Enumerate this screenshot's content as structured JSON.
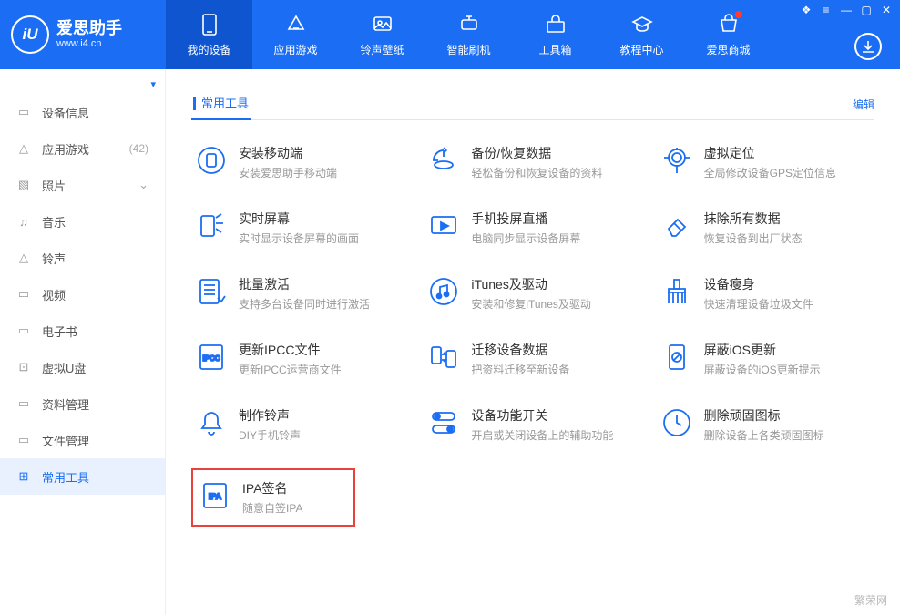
{
  "logo": {
    "badge": "iU",
    "title": "爱思助手",
    "url": "www.i4.cn"
  },
  "topTabs": [
    {
      "label": "我的设备",
      "icon": "device",
      "active": true
    },
    {
      "label": "应用游戏",
      "icon": "apps"
    },
    {
      "label": "铃声壁纸",
      "icon": "wallpaper"
    },
    {
      "label": "智能刷机",
      "icon": "flash"
    },
    {
      "label": "工具箱",
      "icon": "toolbox"
    },
    {
      "label": "教程中心",
      "icon": "edu"
    },
    {
      "label": "爱思商城",
      "icon": "shop",
      "dot": true
    }
  ],
  "sidebar": [
    {
      "label": "设备信息",
      "icon": "info"
    },
    {
      "label": "应用游戏",
      "icon": "apps",
      "count": "(42)"
    },
    {
      "label": "照片",
      "icon": "photo",
      "chevron": true
    },
    {
      "label": "音乐",
      "icon": "music"
    },
    {
      "label": "铃声",
      "icon": "bell"
    },
    {
      "label": "视频",
      "icon": "video"
    },
    {
      "label": "电子书",
      "icon": "book"
    },
    {
      "label": "虚拟U盘",
      "icon": "usb"
    },
    {
      "label": "资料管理",
      "icon": "data"
    },
    {
      "label": "文件管理",
      "icon": "files"
    },
    {
      "label": "常用工具",
      "icon": "tools",
      "active": true
    }
  ],
  "section": {
    "title": "常用工具",
    "edit": "编辑"
  },
  "tools": [
    {
      "title": "安装移动端",
      "desc": "安装爱思助手移动端",
      "icon": "install"
    },
    {
      "title": "备份/恢复数据",
      "desc": "轻松备份和恢复设备的资料",
      "icon": "backup"
    },
    {
      "title": "虚拟定位",
      "desc": "全局修改设备GPS定位信息",
      "icon": "location"
    },
    {
      "title": "实时屏幕",
      "desc": "实时显示设备屏幕的画面",
      "icon": "screen"
    },
    {
      "title": "手机投屏直播",
      "desc": "电脑同步显示设备屏幕",
      "icon": "cast"
    },
    {
      "title": "抹除所有数据",
      "desc": "恢复设备到出厂状态",
      "icon": "erase"
    },
    {
      "title": "批量激活",
      "desc": "支持多台设备同时进行激活",
      "icon": "activate"
    },
    {
      "title": "iTunes及驱动",
      "desc": "安装和修复iTunes及驱动",
      "icon": "itunes"
    },
    {
      "title": "设备瘦身",
      "desc": "快速清理设备垃圾文件",
      "icon": "clean"
    },
    {
      "title": "更新IPCC文件",
      "desc": "更新IPCC运营商文件",
      "icon": "ipcc"
    },
    {
      "title": "迁移设备数据",
      "desc": "把资料迁移至新设备",
      "icon": "migrate"
    },
    {
      "title": "屏蔽iOS更新",
      "desc": "屏蔽设备的iOS更新提示",
      "icon": "block"
    },
    {
      "title": "制作铃声",
      "desc": "DIY手机铃声",
      "icon": "ringtone"
    },
    {
      "title": "设备功能开关",
      "desc": "开启或关闭设备上的辅助功能",
      "icon": "switch"
    },
    {
      "title": "删除顽固图标",
      "desc": "删除设备上各类顽固图标",
      "icon": "deleteicon"
    },
    {
      "title": "IPA签名",
      "desc": "随意自签IPA",
      "icon": "ipa",
      "highlight": true
    }
  ],
  "watermark": "繁荣网"
}
